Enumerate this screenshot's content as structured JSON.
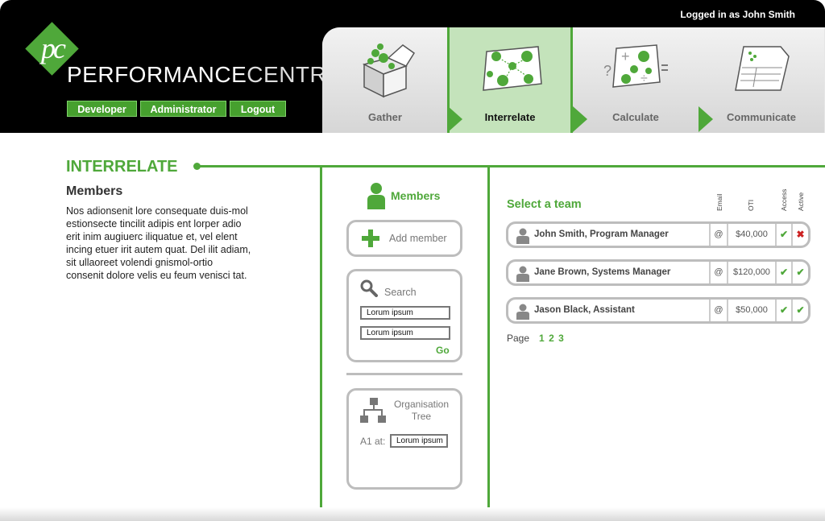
{
  "header": {
    "logged_in": "Logged in as John Smith",
    "logo": {
      "mark": "pc",
      "text_bold": "PERFORMANCE",
      "text_thin": "CENTRE"
    },
    "buttons": [
      "Developer",
      "Administrator",
      "Logout"
    ]
  },
  "tabs": [
    {
      "label": "Gather",
      "icon": "box-icon",
      "active": false
    },
    {
      "label": "Interrelate",
      "icon": "network-icon",
      "active": true
    },
    {
      "label": "Calculate",
      "icon": "calculate-icon",
      "active": false
    },
    {
      "label": "Communicate",
      "icon": "document-icon",
      "active": false
    }
  ],
  "page": {
    "title": "INTERRELATE",
    "section_title": "Members",
    "description": "Nos adionsenit lore consequate duis-mol estionsecte tincilit adipis ent lorper adio erit inim augiuerc iliquatue et, vel elent incing etuer irit autem quat. Del ilit adiam, sit ullaoreet volendi gnismol-ortio consenit dolore velis eu feum venisci tat."
  },
  "members_panel": {
    "title": "Members",
    "add_label": "Add member",
    "search": {
      "label": "Search",
      "field1": "Lorum ipsum",
      "field2": "Lorum ipsum",
      "go": "Go"
    },
    "org_tree": {
      "label": "Organisation Tree",
      "field_label": "A1 at:",
      "field_value": "Lorum ipsum"
    }
  },
  "team": {
    "title": "Select a team",
    "columns": {
      "email": "Email",
      "oti": "OTI",
      "access": "Access",
      "active": "Active"
    },
    "rows": [
      {
        "name": "John Smith, Program Manager",
        "email": "@",
        "oti": "$40,000",
        "access": "✔",
        "active": "✖"
      },
      {
        "name": "Jane Brown, Systems Manager",
        "email": "@",
        "oti": "$120,000",
        "access": "✔",
        "active": "✔"
      },
      {
        "name": "Jason Black, Assistant",
        "email": "@",
        "oti": "$50,000",
        "access": "✔",
        "active": "✔"
      }
    ],
    "pager": {
      "label": "Page",
      "pages": [
        "1",
        "2",
        "3"
      ]
    }
  },
  "colors": {
    "accent": "#4fa83a",
    "header_bg": "#000000",
    "active_tab": "#c4e3bb",
    "border": "#bdbdbd"
  }
}
